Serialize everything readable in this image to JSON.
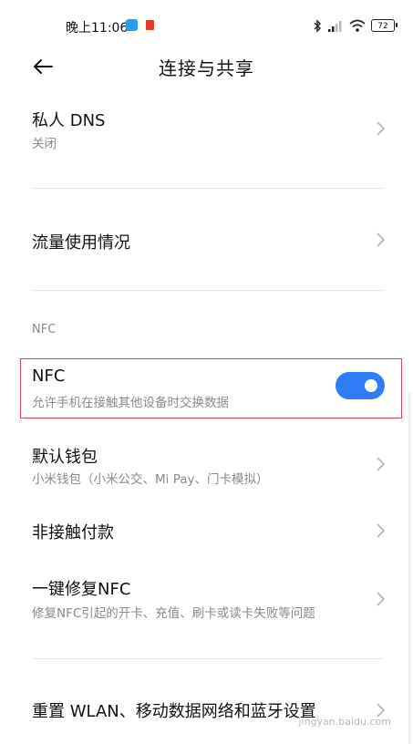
{
  "status_bar": {
    "time": "晚上11:06",
    "battery": "72"
  },
  "header": {
    "title": "连接与共享"
  },
  "items": {
    "private_dns": {
      "title": "私人 DNS",
      "subtitle": "关闭"
    },
    "data_usage": {
      "title": "流量使用情况"
    },
    "nfc_section_label": "NFC",
    "nfc": {
      "title": "NFC",
      "subtitle": "允许手机在接触其他设备时交换数据",
      "enabled": true
    },
    "default_wallet": {
      "title": "默认钱包",
      "subtitle": "小米钱包（小米公交、Mi Pay、门卡模拟）"
    },
    "contactless_payment": {
      "title": "非接触付款"
    },
    "repair_nfc": {
      "title": "一键修复NFC",
      "subtitle": "修复NFC引起的开卡、充值、刷卡或读卡失败等问题"
    },
    "reset_network": {
      "title": "重置 WLAN、移动数据网络和蓝牙设置"
    }
  },
  "watermark": "jingyan.baidu.com",
  "colors": {
    "accent": "#2f7cf6",
    "highlight_border": "#e0474c"
  }
}
